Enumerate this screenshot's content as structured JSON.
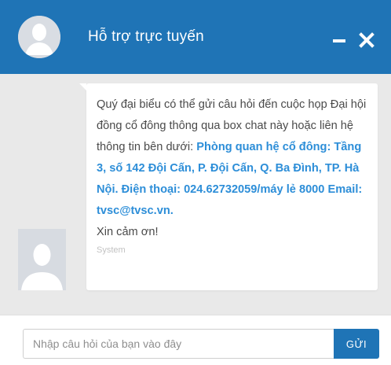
{
  "header": {
    "title": "Hỗ trợ trực tuyến",
    "minimize_icon": "minimize-icon",
    "close_icon": "close-icon"
  },
  "message": {
    "text_intro": "Quý đại biểu có thể gửi câu hỏi đến cuộc họp Đại hội đồng cổ đông thông qua box chat này hoặc liên hệ thông tin bên dưới: ",
    "text_contact": "Phòng quan hệ cổ đông: Tầng 3, số 142 Đội Cấn, P. Đội Cấn, Q. Ba Đình, TP. Hà Nội. Điện thoại: 024.62732059/máy lẻ 8000 Email: tvsc@tvsc.vn.",
    "thanks": "Xin cảm ơn!",
    "sender": "System"
  },
  "input": {
    "placeholder": "Nhập câu hỏi của bạn vào đây",
    "value": "",
    "send_label": "GỬI"
  },
  "colors": {
    "primary": "#1f74b6",
    "link": "#2d8ed8",
    "background": "#e9e9e9"
  }
}
